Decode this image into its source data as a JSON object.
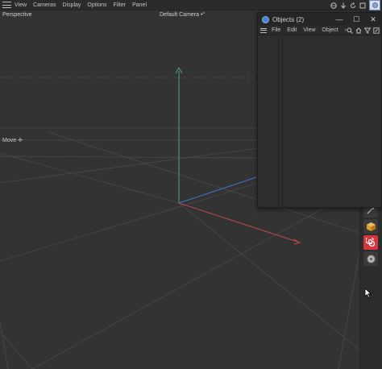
{
  "viewport_menu": {
    "items": [
      "View",
      "Cameras",
      "Display",
      "Options",
      "Filter",
      "Panel"
    ]
  },
  "viewport": {
    "projection_label": "Perspective",
    "camera_label": "Default Camera",
    "camera_icon_glyph": "•°",
    "tool_label": "Move",
    "tool_icon_glyph": "✛"
  },
  "objects_window": {
    "title": "Objects (2)",
    "minimize_glyph": "—",
    "maximize_glyph": "☐",
    "close_glyph": "✕",
    "menu": [
      "File",
      "Edit",
      "View",
      "Object"
    ],
    "more_glyph": "›"
  },
  "colors": {
    "background": "#333333",
    "axis_x": "#b94a4a",
    "axis_y": "#4fa86b",
    "axis_z": "#3a78c8",
    "grid": "#4a4a4a",
    "spline_tool": "#d9343a",
    "cube_tool": "#e0a030"
  },
  "icons": {
    "top_right": [
      "sphere-icon",
      "arrow-down-icon",
      "rotate-icon",
      "render-icon"
    ],
    "objects_toolbar": [
      "search-icon",
      "home-icon",
      "filter-icon",
      "expand-icon"
    ],
    "toolstrip": [
      "spline-pen-icon",
      "cube-icon",
      "spline-icon",
      "gear-icon"
    ]
  }
}
